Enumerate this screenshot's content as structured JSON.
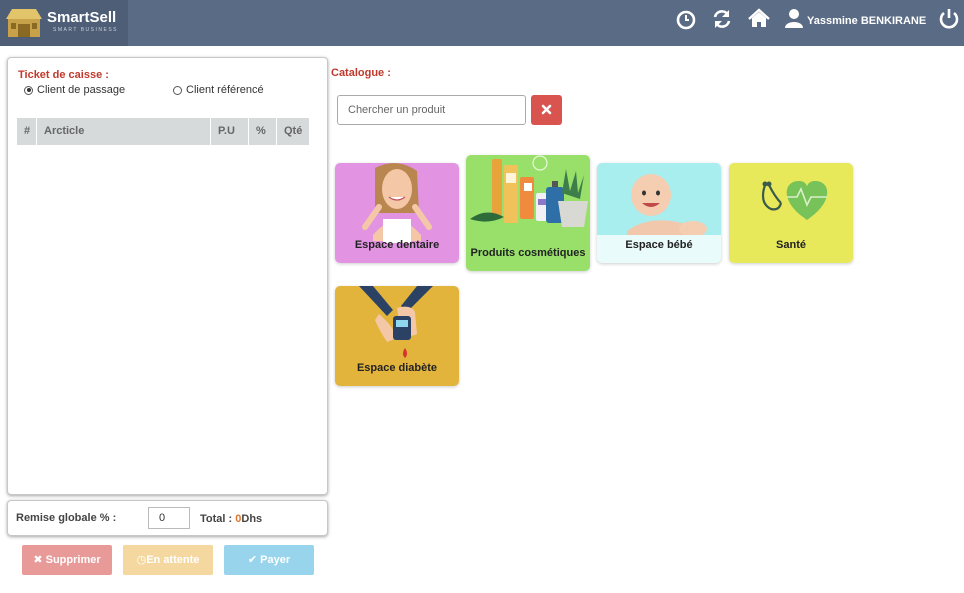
{
  "header": {
    "brand_name": "SmartSell",
    "brand_tagline": "SMART BUSINESS",
    "user_name": "Yassmine BENKIRANE"
  },
  "ticket": {
    "title": "Ticket de caisse :",
    "radio_passage": "Client de passage",
    "radio_reference": "Client référencé",
    "selected_client": "Client de passage",
    "columns": [
      "#",
      "Arcticle",
      "P.U",
      "%",
      "Qté"
    ]
  },
  "footer": {
    "remise_label": "Remise globale % :",
    "remise_value": "0",
    "total_label": "Total :",
    "total_amount": "0",
    "total_unit": "Dhs"
  },
  "actions": {
    "delete_label": "Supprimer",
    "wait_label": "En attente",
    "pay_label": "Payer"
  },
  "catalogue": {
    "title": "Catalogue :",
    "search_placeholder": "Chercher un produit",
    "categories": [
      {
        "label": "Espace dentaire",
        "color": "#e294e3"
      },
      {
        "label": "Produits cosmétiques",
        "color": "#98e06a"
      },
      {
        "label": "Espace bébé",
        "color": "#a8eeee"
      },
      {
        "label": "Santé",
        "color": "#e8e95a"
      },
      {
        "label": "Espace diabète",
        "color": "#e2b43c"
      }
    ]
  }
}
